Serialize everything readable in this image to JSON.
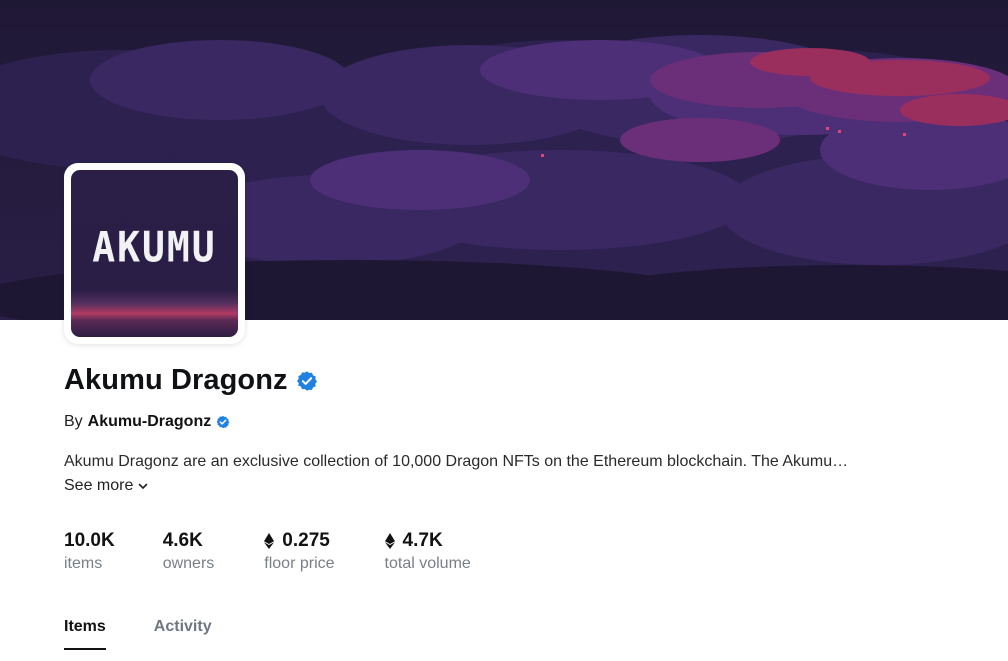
{
  "collection": {
    "name": "Akumu Dragonz",
    "verified": true,
    "avatar_text": "AKUMU",
    "creator_prefix": "By",
    "creator_name": "Akumu-Dragonz",
    "creator_verified": true,
    "description": "Akumu Dragonz are an exclusive collection of 10,000 Dragon NFTs on the Ethereum blockchain. The Akumu…",
    "see_more_label": "See more"
  },
  "stats": [
    {
      "value": "10.0K",
      "label": "items",
      "icon": null
    },
    {
      "value": "4.6K",
      "label": "owners",
      "icon": null
    },
    {
      "value": "0.275",
      "label": "floor price",
      "icon": "ethereum-icon"
    },
    {
      "value": "4.7K",
      "label": "total volume",
      "icon": "ethereum-icon"
    }
  ],
  "tabs": [
    {
      "label": "Items",
      "active": true
    },
    {
      "label": "Activity",
      "active": false
    }
  ],
  "colors": {
    "verified_blue": "#2081e2",
    "banner_base": "#221a3a",
    "banner_accent": "#b83a5c",
    "muted_text": "#7a7f87"
  }
}
